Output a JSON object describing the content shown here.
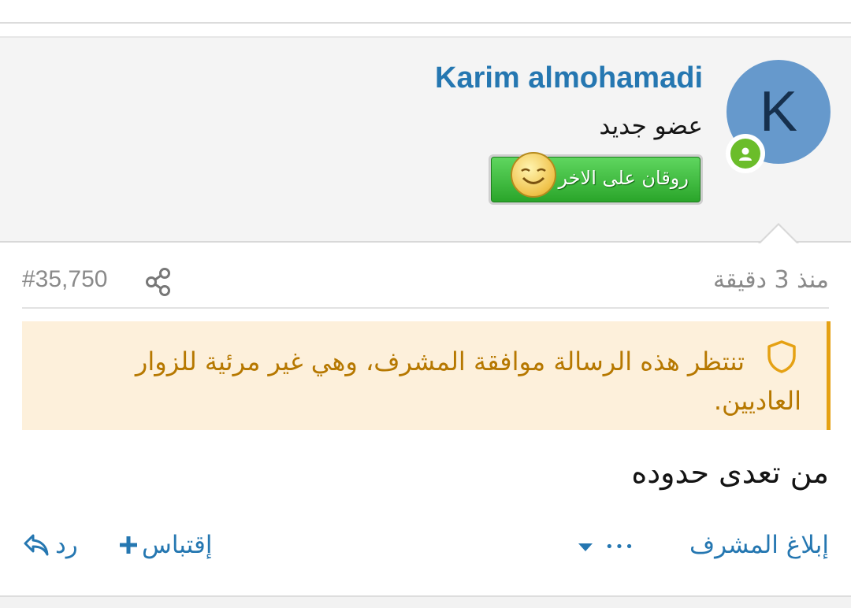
{
  "post": {
    "username": "Karim almohamadi",
    "user_title": "عضو جديد",
    "avatar_letter": "K",
    "rank_banner": "روقان على الاخر",
    "time": "منذ 3 دقيقة",
    "post_number": "#35,750",
    "moderation_notice": "تنتظر هذه الرسالة موافقة المشرف، وهي غير مرئية للزوار العاديين.",
    "message": "من تعدى حدوده"
  },
  "actions": {
    "report": "إبلاغ المشرف",
    "more": "•••",
    "quote": "إقتباس",
    "reply": "رد"
  },
  "colors": {
    "link": "#2577b1",
    "avatar_bg": "#6699cc",
    "online": "#6bbd2a",
    "notice_bg": "#fdf0db",
    "notice_border": "#e5a113",
    "notice_text": "#b67800"
  },
  "icons": [
    "share-icon",
    "shield-icon",
    "online-status-icon",
    "smiley-icon",
    "chevron-down-icon",
    "plus-icon",
    "reply-arrow-icon"
  ]
}
